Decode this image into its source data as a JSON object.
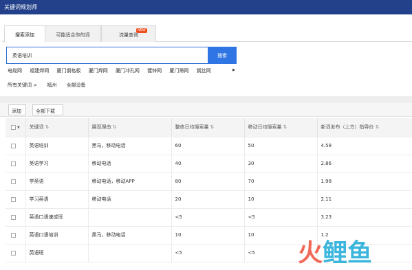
{
  "app": {
    "title": "关键词规划师"
  },
  "tabs": [
    {
      "label": "搜索添加",
      "active": true
    },
    {
      "label": "可能适合你的词",
      "active": false
    },
    {
      "label": "流量查询",
      "active": false,
      "badge": "NEW"
    }
  ],
  "search": {
    "value": "英语培训",
    "button_label": "搜索"
  },
  "suggestions": [
    "电缆网",
    "福建焊网",
    "厦门钢格板",
    "厦门焊网",
    "厦门冲孔网",
    "镀锌网",
    "厦门筛网",
    "钢丝网"
  ],
  "breadcrumb": {
    "scope": "所有关键词 >",
    "location": "福州",
    "device": "全部设备"
  },
  "toolbar": {
    "add_label": "添加",
    "download_label": "全部下载"
  },
  "table": {
    "columns": [
      "关键词",
      "展现理由",
      "整体日均搜索量",
      "移动日均搜索量",
      "新词发布（上方）指导价"
    ],
    "rows": [
      {
        "keyword": "英语培训",
        "reason": "黑马，移动电话",
        "total": "60",
        "mobile": "50",
        "price": "4.58"
      },
      {
        "keyword": "英语学习",
        "reason": "移动电话",
        "total": "40",
        "mobile": "30",
        "price": "2.86"
      },
      {
        "keyword": "学英语",
        "reason": "移动电话，移动APP",
        "total": "80",
        "mobile": "70",
        "price": "1.98"
      },
      {
        "keyword": "学习英语",
        "reason": "移动电话",
        "total": "20",
        "mobile": "10",
        "price": "2.11"
      },
      {
        "keyword": "英语口语速成班",
        "reason": "",
        "total": "<5",
        "mobile": "<5",
        "price": "3.23"
      },
      {
        "keyword": "英语口语培训",
        "reason": "黑马，移动电话",
        "total": "10",
        "mobile": "10",
        "price": "1.2"
      },
      {
        "keyword": "英语班",
        "reason": "",
        "total": "<5",
        "mobile": "<5",
        "price": ""
      }
    ]
  },
  "watermark": {
    "text": "火鲤鱼",
    "colors": [
      "#f04e3b",
      "#1aa9d6",
      "#1aa9d6"
    ]
  },
  "colors": {
    "titlebar": "#23418a",
    "search_button": "#2f75e3",
    "badge": "#f04d1d"
  }
}
